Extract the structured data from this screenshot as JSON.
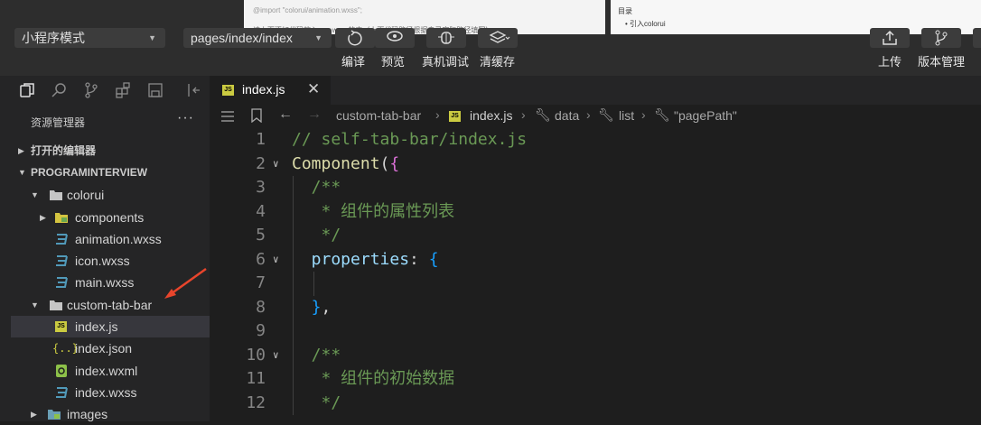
{
  "toolbar": {
    "mode_select": "小程序模式",
    "page_select": "pages/index/index",
    "compile_label": "编译",
    "preview_label": "预览",
    "debug_label": "真机调试",
    "clear_cache_label": "清缓存",
    "upload_label": "上传",
    "version_label": "版本管理",
    "doc_text": "请上面添加代码放入app.wxss的中（上面代码路径根据自己实际路径填写）",
    "doc_right_title": "目录",
    "doc_right_item": "引入colorui"
  },
  "sidebar": {
    "explorer_title": "资源管理器",
    "more": "···",
    "open_editors": "打开的编辑器",
    "project": "PROGRAMINTERVIEW",
    "tree": [
      {
        "label": "colorui"
      },
      {
        "label": "components"
      },
      {
        "label": "animation.wxss"
      },
      {
        "label": "icon.wxss"
      },
      {
        "label": "main.wxss"
      },
      {
        "label": "custom-tab-bar"
      },
      {
        "label": "index.js"
      },
      {
        "label": "index.json"
      },
      {
        "label": "index.wxml"
      },
      {
        "label": "index.wxss"
      },
      {
        "label": "images"
      }
    ]
  },
  "editor": {
    "tab_label": "index.js",
    "breadcrumb": [
      "custom-tab-bar",
      "index.js",
      "data",
      "list",
      "\"pagePath\""
    ],
    "lines": [
      {
        "n": "1",
        "parts": [
          [
            "// self-tab-bar/index.js",
            "c-com"
          ]
        ]
      },
      {
        "n": "2",
        "parts": [
          [
            "Component",
            "c-fn"
          ],
          [
            "(",
            "c-p"
          ],
          [
            "{",
            "c-b1"
          ]
        ]
      },
      {
        "n": "3",
        "parts": [
          [
            "  /**",
            "c-com"
          ]
        ]
      },
      {
        "n": "4",
        "parts": [
          [
            "   * 组件的属性列表",
            "c-com"
          ]
        ]
      },
      {
        "n": "5",
        "parts": [
          [
            "   */",
            "c-com"
          ]
        ]
      },
      {
        "n": "6",
        "parts": [
          [
            "  properties",
            "c-prop"
          ],
          [
            ": ",
            "c-p"
          ],
          [
            "{",
            "c-b2"
          ]
        ]
      },
      {
        "n": "7",
        "parts": []
      },
      {
        "n": "8",
        "parts": [
          [
            "  }",
            "c-b2"
          ],
          [
            ",",
            "c-p"
          ]
        ]
      },
      {
        "n": "9",
        "parts": []
      },
      {
        "n": "10",
        "parts": [
          [
            "  /**",
            "c-com"
          ]
        ]
      },
      {
        "n": "11",
        "parts": [
          [
            "   * 组件的初始数据",
            "c-com"
          ]
        ]
      },
      {
        "n": "12",
        "parts": [
          [
            "   */",
            "c-com"
          ]
        ]
      }
    ]
  },
  "colors": {
    "accent": "#cbcb41",
    "arrow": "#e8452c"
  }
}
